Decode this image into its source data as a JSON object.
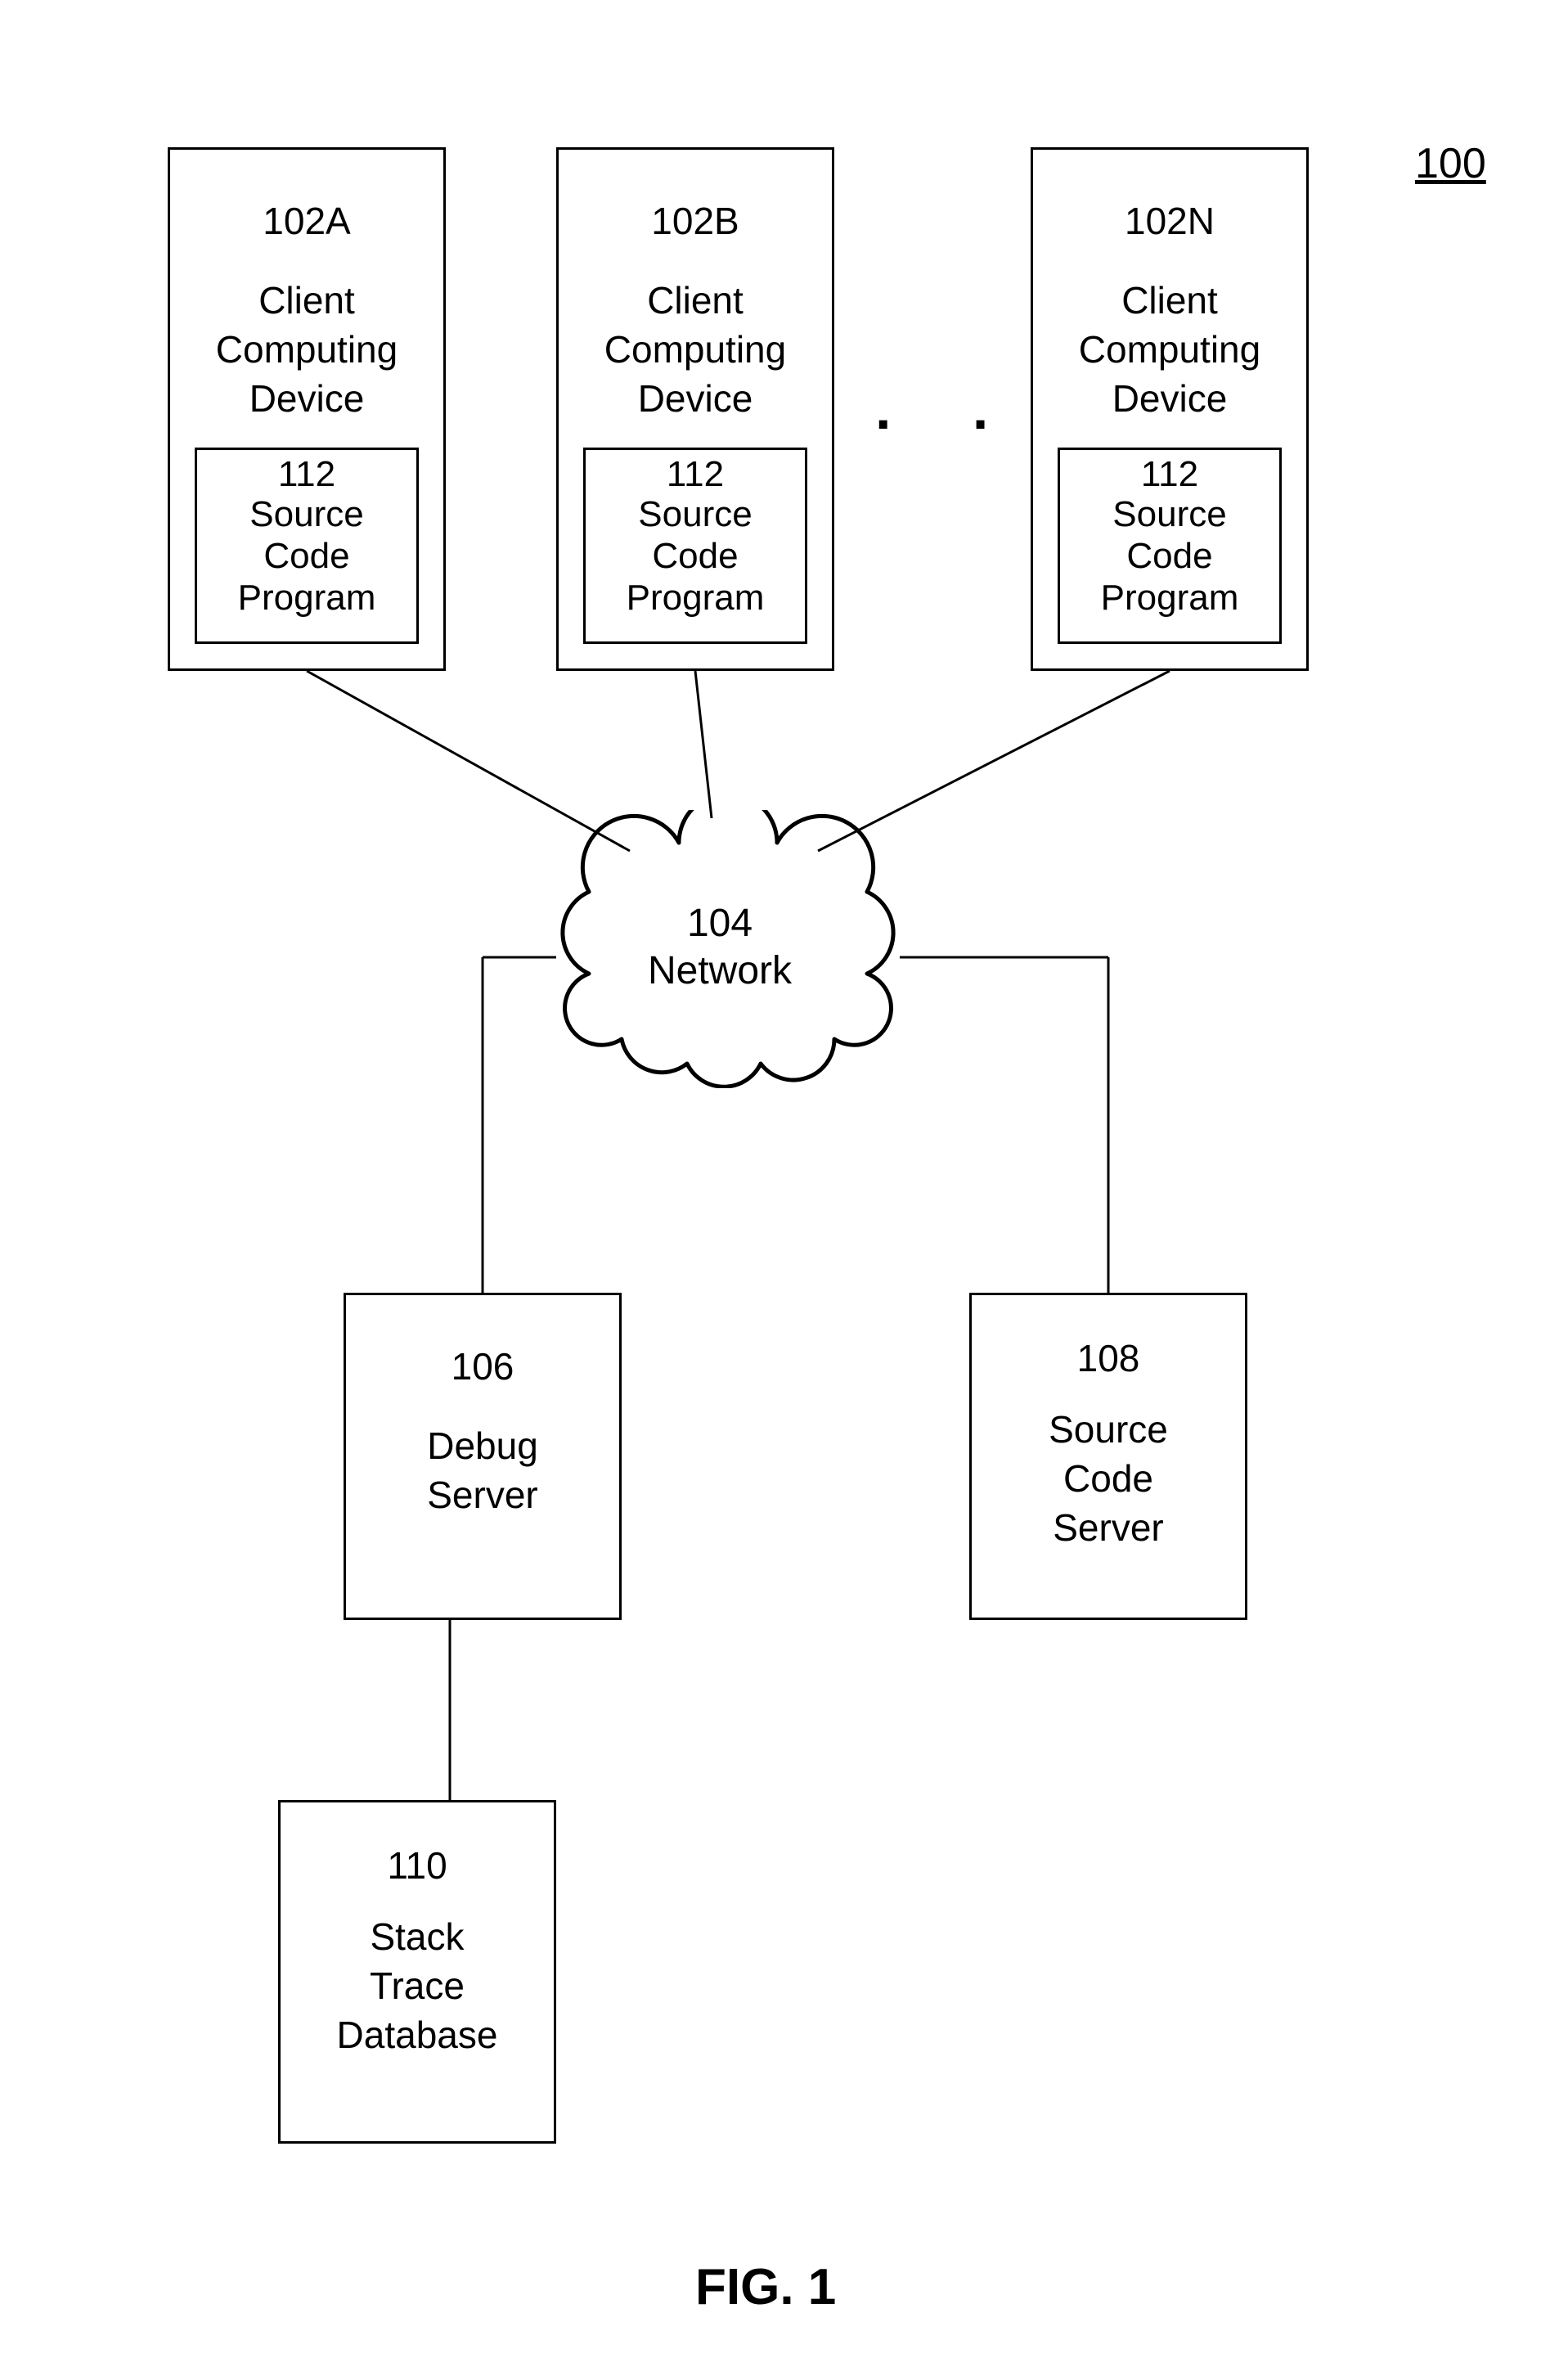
{
  "system_ref": "100",
  "clients": [
    {
      "ref": "102A",
      "label_l1": "Client",
      "label_l2": "Computing",
      "label_l3": "Device"
    },
    {
      "ref": "102B",
      "label_l1": "Client",
      "label_l2": "Computing",
      "label_l3": "Device"
    },
    {
      "ref": "102N",
      "label_l1": "Client",
      "label_l2": "Computing",
      "label_l3": "Device"
    }
  ],
  "source_code_program": {
    "ref": "112",
    "label_l1": "Source",
    "label_l2": "Code",
    "label_l3": "Program"
  },
  "network": {
    "ref": "104",
    "label": "Network"
  },
  "debug_server": {
    "ref": "106",
    "label_l1": "Debug",
    "label_l2": "Server"
  },
  "source_code_server": {
    "ref": "108",
    "label_l1": "Source",
    "label_l2": "Code",
    "label_l3": "Server"
  },
  "stack_trace_db": {
    "ref": "110",
    "label_l1": "Stack",
    "label_l2": "Trace",
    "label_l3": "Database"
  },
  "figure_caption": "FIG. 1",
  "ellipsis": ". . ."
}
